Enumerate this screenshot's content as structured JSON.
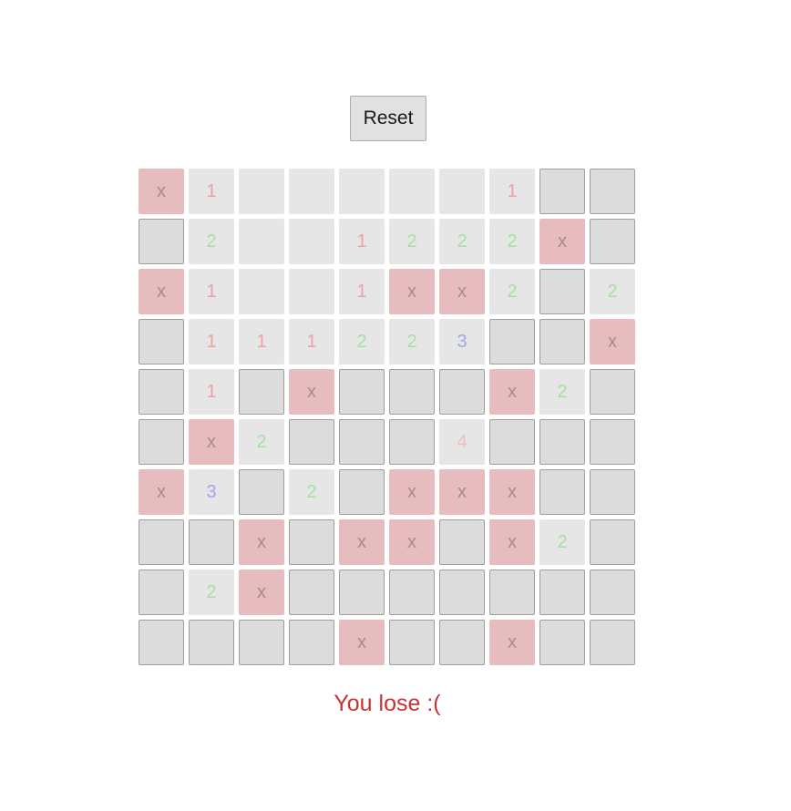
{
  "reset_label": "Reset",
  "status_message": "You lose :(",
  "colors": {
    "number_1": "#eea0a4",
    "number_2": "#a4e0a0",
    "number_3": "#a4a4e8",
    "number_4": "#ecc0c0",
    "mine_bg": "#e6bcbf",
    "status": "#c83232"
  },
  "board": [
    [
      "x",
      "1",
      "",
      "",
      "",
      "",
      "",
      "1",
      "#",
      "#"
    ],
    [
      "#",
      "2",
      "",
      "",
      "1",
      "2",
      "2",
      "2",
      "x",
      "#"
    ],
    [
      "x",
      "1",
      "",
      "",
      "1",
      "x",
      "x",
      "2",
      "#",
      "2"
    ],
    [
      "#",
      "1",
      "1",
      "1",
      "2",
      "2",
      "3",
      "#",
      "#",
      "x"
    ],
    [
      "#",
      "1",
      "#",
      "x",
      "#",
      "#",
      "#",
      "x",
      "2",
      "#"
    ],
    [
      "#",
      "x",
      "2",
      "#",
      "#",
      "#",
      "4",
      "#",
      "#",
      "#"
    ],
    [
      "x",
      "3",
      "#",
      "2",
      "#",
      "x",
      "x",
      "x",
      "#",
      "#"
    ],
    [
      "#",
      "#",
      "x",
      "#",
      "x",
      "x",
      "#",
      "x",
      "2",
      "#"
    ],
    [
      "#",
      "2",
      "x",
      "#",
      "#",
      "#",
      "#",
      "#",
      "#",
      "#"
    ],
    [
      "#",
      "#",
      "#",
      "#",
      "x",
      "#",
      "#",
      "x",
      "#",
      "#"
    ]
  ]
}
